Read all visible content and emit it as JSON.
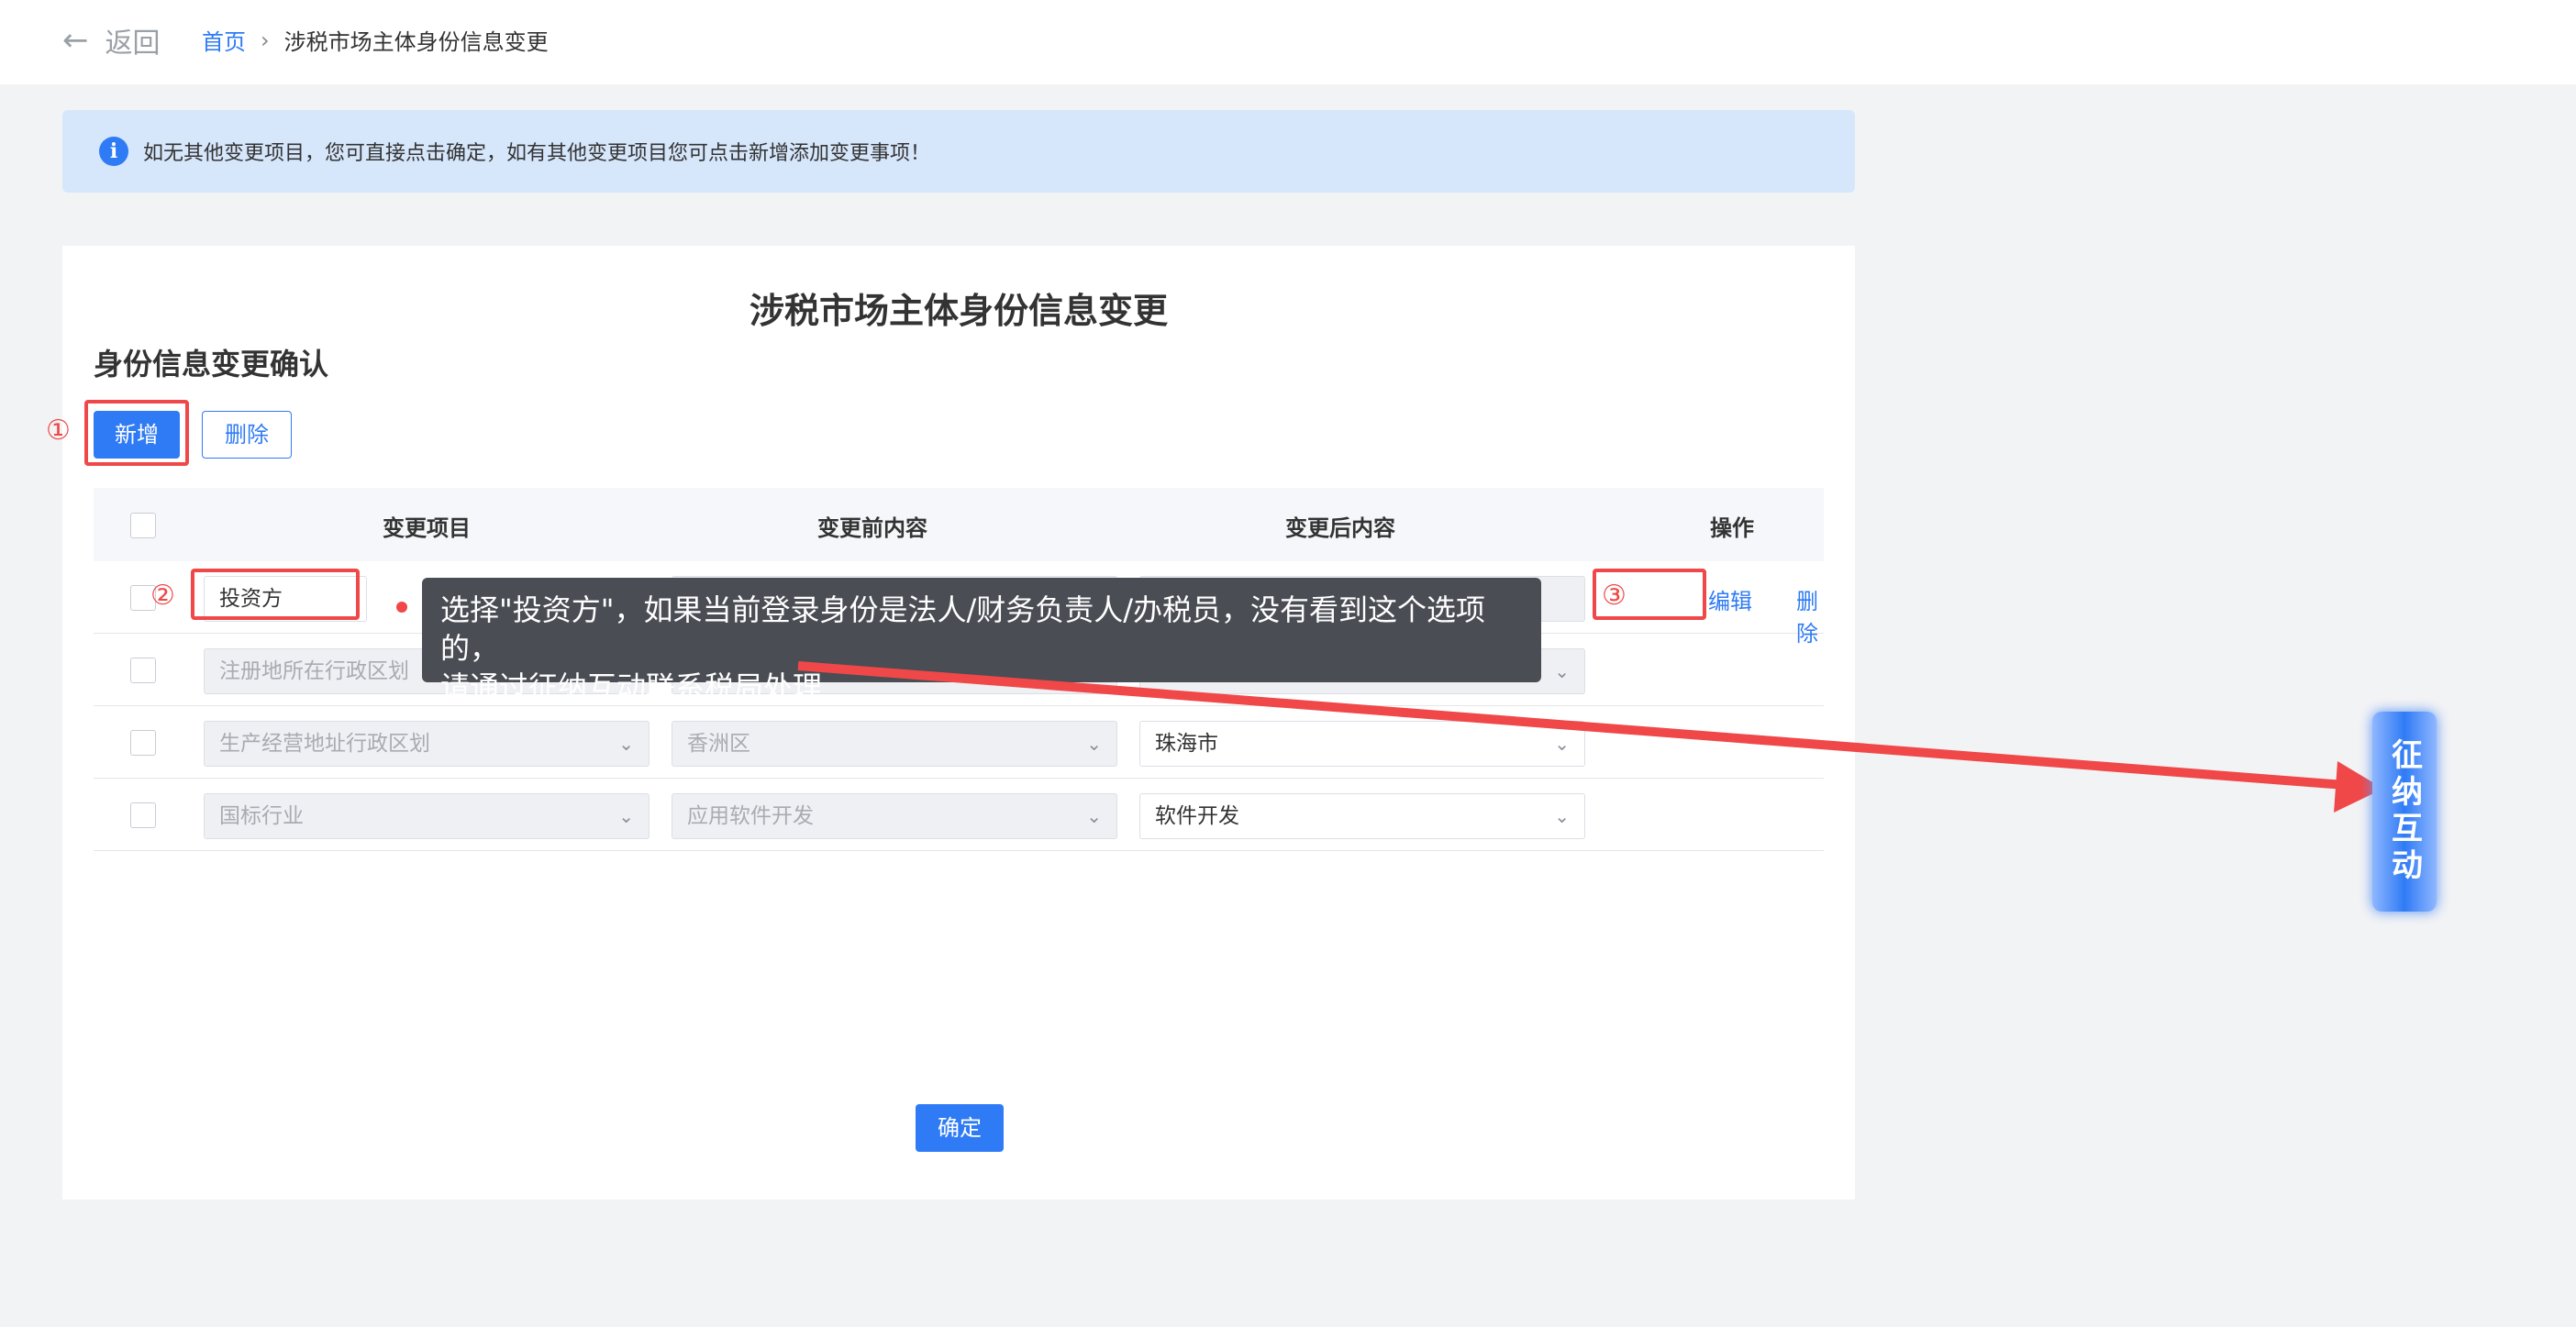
{
  "header": {
    "back_label": "返回",
    "breadcrumb_home": "首页",
    "breadcrumb_sep": "›",
    "breadcrumb_current": "涉税市场主体身份信息变更"
  },
  "alert": {
    "icon": "i",
    "text": "如无其他变更项目，您可直接点击确定，如有其他变更项目您可点击新增添加变更事项！"
  },
  "page": {
    "title": "涉税市场主体身份信息变更",
    "subtitle": "身份信息变更确认",
    "add_button": "新增",
    "delete_button": "删除",
    "confirm_button": "确定"
  },
  "table": {
    "headers": [
      "变更项目",
      "变更前内容",
      "变更后内容",
      "操作"
    ],
    "rows": [
      {
        "item": "投资方",
        "before": "",
        "after": "",
        "edit": "编辑",
        "delete": "删除"
      },
      {
        "item": "注册地所在行政区划",
        "before": "",
        "after": ""
      },
      {
        "item": "生产经营地址行政区划",
        "before": "香洲区",
        "after": "珠海市"
      },
      {
        "item": "国标行业",
        "before": "应用软件开发",
        "after": "软件开发"
      }
    ]
  },
  "annotations": {
    "step1": "①",
    "step2": "②",
    "step3": "③",
    "tooltip_line1": "选择\"投资方\"，如果当前登录身份是法人/财务负责人/办税员，没有看到这个选项的，",
    "tooltip_line2": "请通过征纳互动联系税局处理",
    "accent_color": "#f04848"
  },
  "float_widget": {
    "label": "征纳互动",
    "color": "#2f7bf5"
  }
}
